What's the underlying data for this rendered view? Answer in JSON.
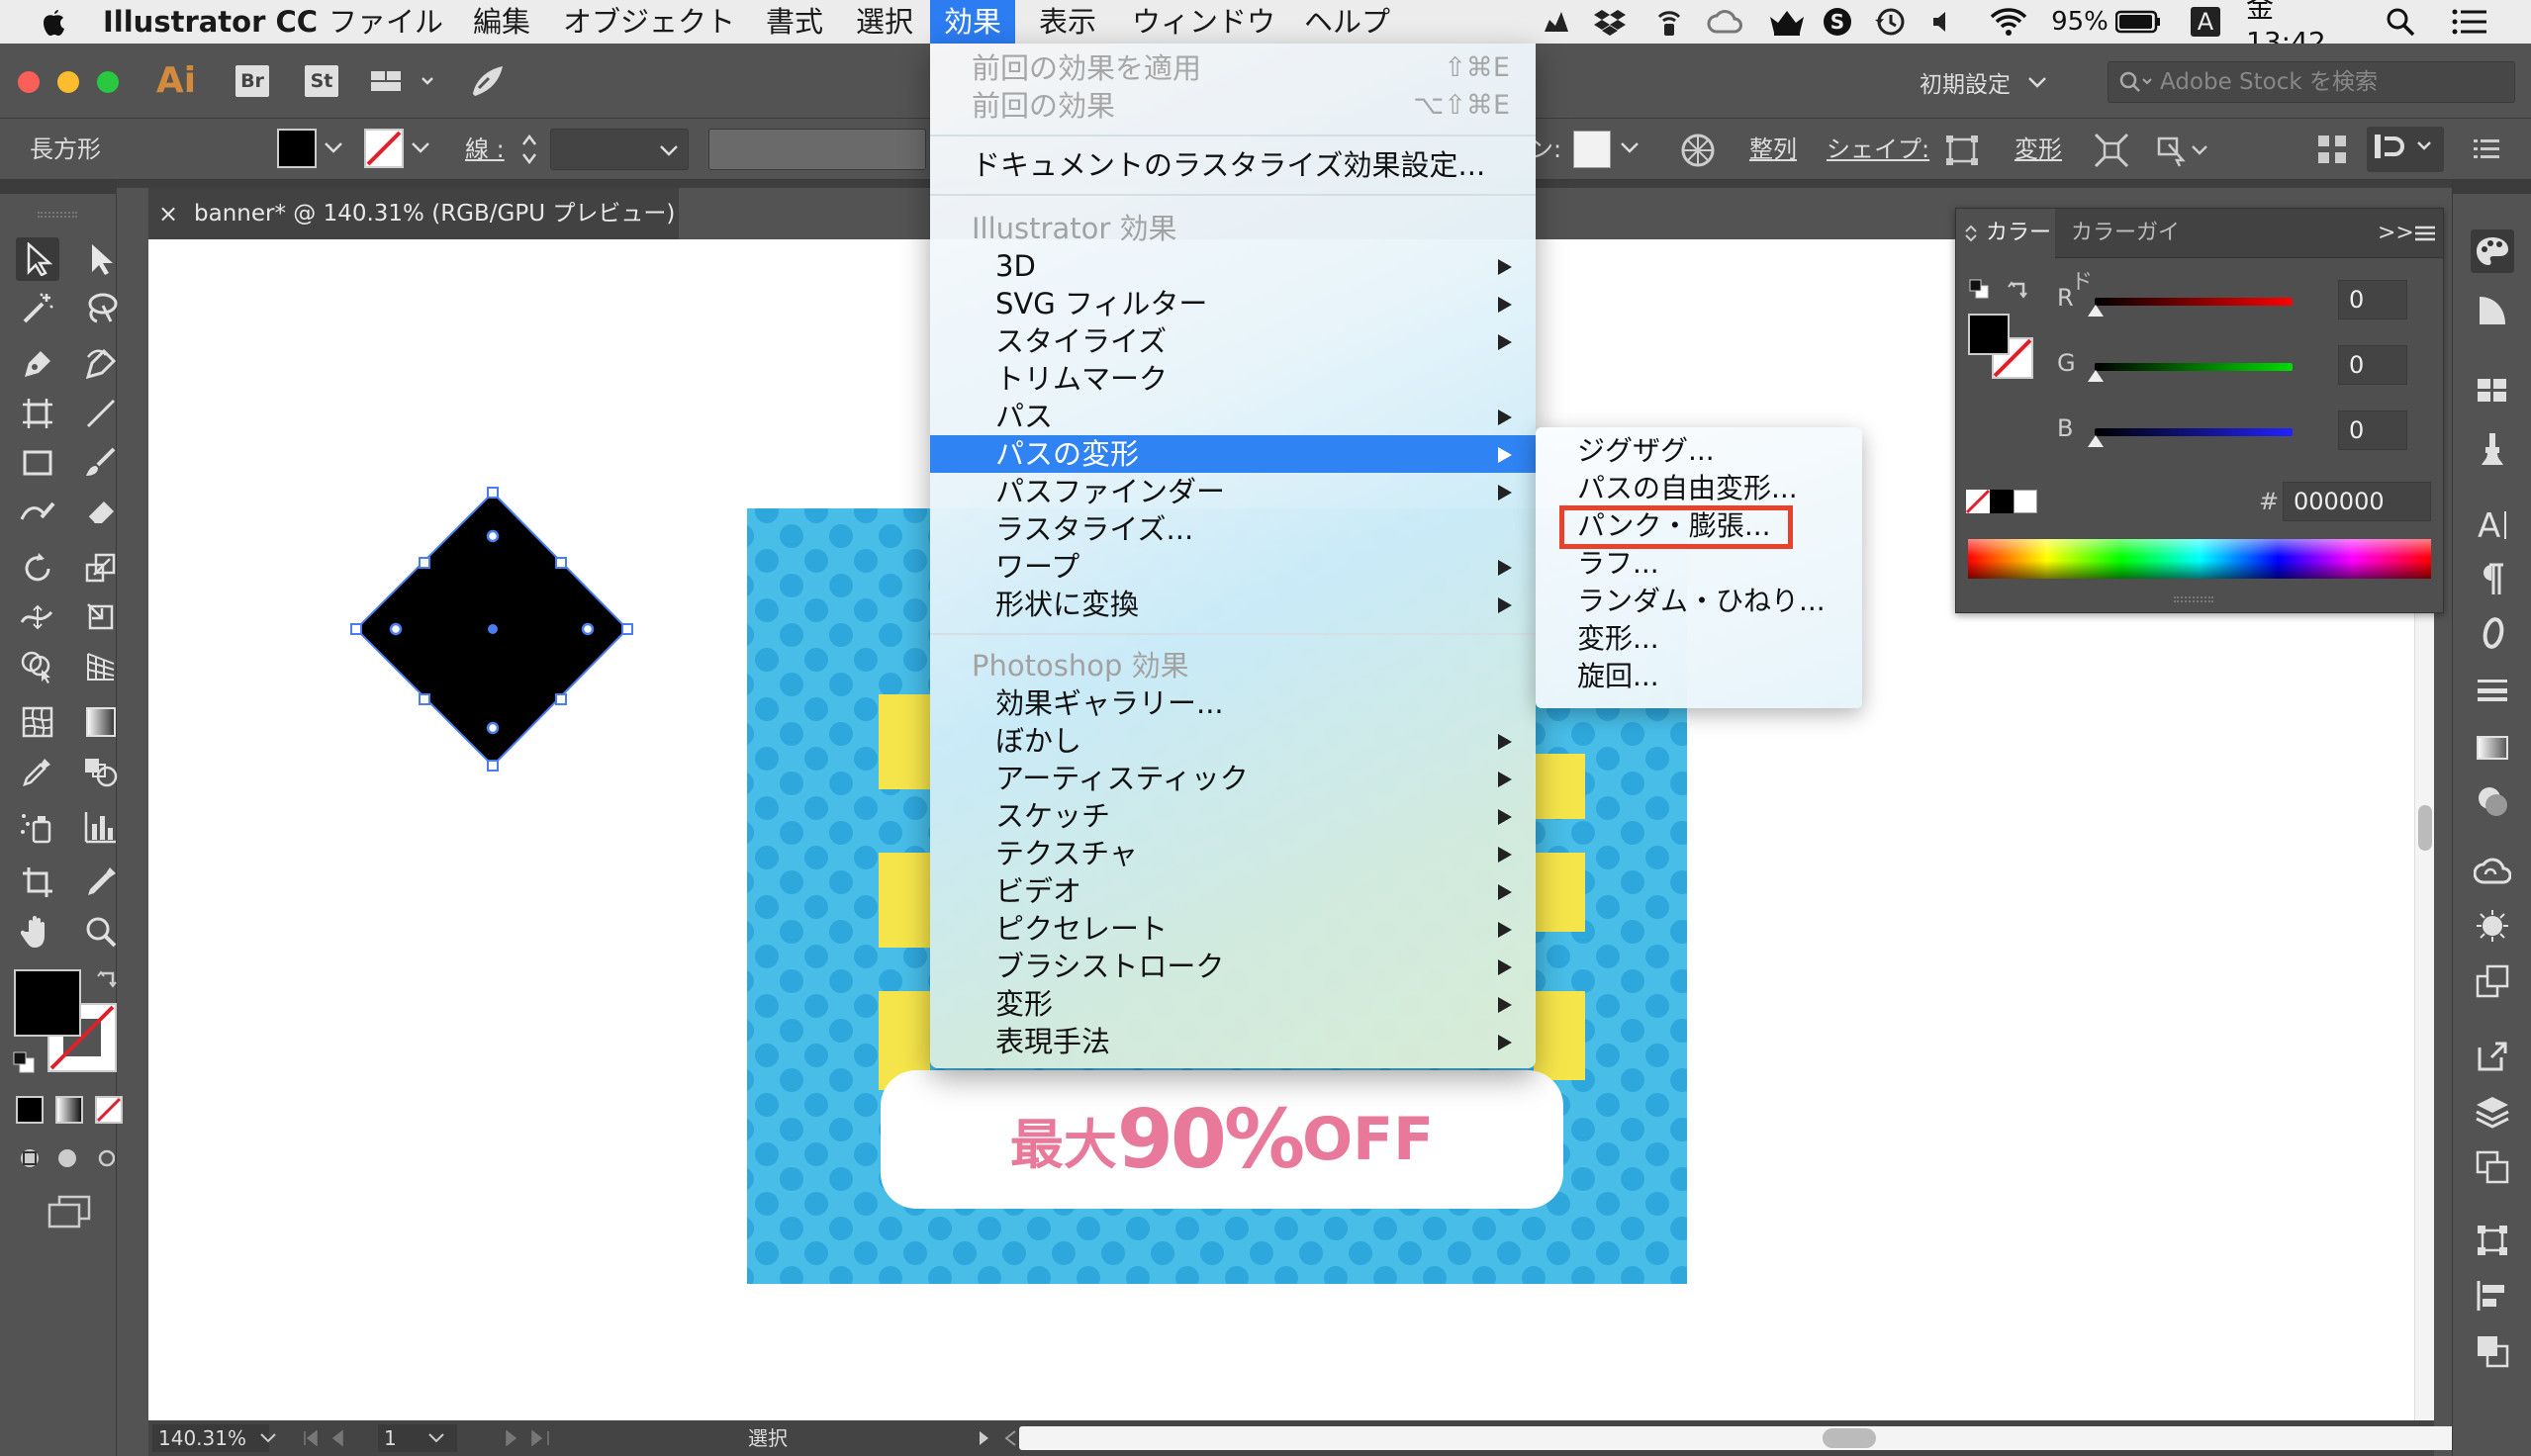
{
  "menubar": {
    "app_name": "Illustrator CC",
    "items": [
      "ファイル",
      "編集",
      "オブジェクト",
      "書式",
      "選択",
      "効果",
      "表示",
      "ウィンドウ",
      "ヘルプ"
    ],
    "battery": "95%",
    "input_mode": "A",
    "clock": "金 13:42"
  },
  "appbar": {
    "logo": "Ai",
    "bridge": "Br",
    "stock": "St",
    "workspace": "初期設定",
    "search_placeholder": "Adobe Stock を検索"
  },
  "control": {
    "object_label": "長方形",
    "stroke_label": "線 :",
    "align_label": "整列",
    "shape_label": "シェイプ:",
    "transform_label": "変形",
    "opacity_fragment": "ン:"
  },
  "document": {
    "tab_title": "banner* @ 140.31% (RGB/GPU プレビュー)",
    "close": "×"
  },
  "status": {
    "zoom": "140.31%",
    "artboard": "1",
    "tool": "選択"
  },
  "canvas": {
    "banner_text_main": "最大",
    "banner_text_num": "90%",
    "banner_text_off": "OFF",
    "banner_color": "#47bde8",
    "dot_color": "#2ea7dc",
    "accent_pink": "#e8799b"
  },
  "color_panel": {
    "tab_color": "カラー",
    "tab_guide": "カラーガイド",
    "expand": ">>",
    "r_label": "R",
    "g_label": "G",
    "b_label": "B",
    "r_value": "0",
    "g_value": "0",
    "b_value": "0",
    "hash": "#",
    "hex_value": "000000"
  },
  "effect_menu": {
    "apply_last": "前回の効果を適用",
    "apply_last_sc": "⇧⌘E",
    "last": "前回の効果",
    "last_sc": "⌥⇧⌘E",
    "raster_settings": "ドキュメントのラスタライズ効果設定...",
    "illustrator_header": "Illustrator 効果",
    "illustrator_items": [
      "3D",
      "SVG フィルター",
      "スタイライズ",
      "トリムマーク",
      "パス",
      "パスの変形",
      "パスファインダー",
      "ラスタライズ...",
      "ワープ",
      "形状に変換"
    ],
    "photoshop_header": "Photoshop 効果",
    "photoshop_items": [
      "効果ギャラリー...",
      "ぼかし",
      "アーティスティック",
      "スケッチ",
      "テクスチャ",
      "ビデオ",
      "ピクセレート",
      "ブラシストローク",
      "変形",
      "表現手法"
    ]
  },
  "distort_submenu": {
    "items": [
      "ジグザグ...",
      "パスの自由変形...",
      "パンク・膨張...",
      "ラフ...",
      "ランダム・ひねり...",
      "変形...",
      "旋回..."
    ],
    "highlight_color": "#e8412c"
  }
}
